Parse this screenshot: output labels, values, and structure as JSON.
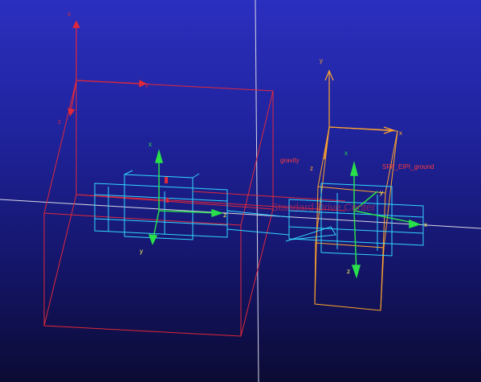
{
  "scene": {
    "labels": {
      "gravity": "gravity",
      "ground": "SFP_EIPI_ground",
      "center": "Standard Drive Center"
    },
    "axes": {
      "x": "x",
      "y": "y",
      "z": "z"
    },
    "colors": {
      "red_body": "#e0283a",
      "orange_body": "#ffa42c",
      "cyan_shaft": "#33d6ff",
      "green_axis": "#29e04a",
      "crosshair": "#d8d8e6",
      "label_red": "#ff3a3a"
    }
  }
}
